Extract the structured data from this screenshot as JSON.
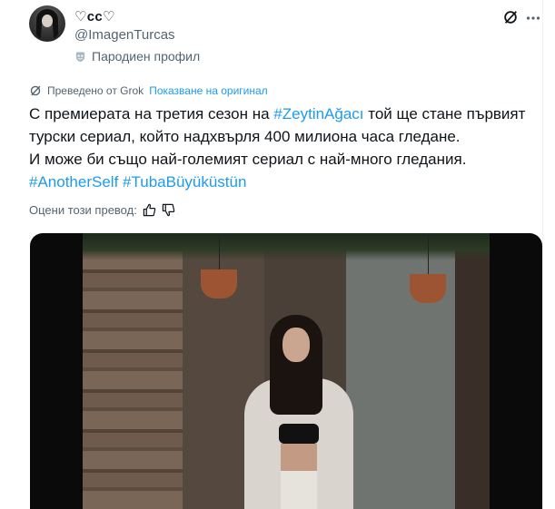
{
  "author": {
    "display_name": "♡ᴄᴄ♡",
    "handle": "@ImagenTurcas",
    "label": "Пародиен профил"
  },
  "translation": {
    "translated_from": "Преведено от Grok",
    "show_original": "Показване на оригинал"
  },
  "tweet": {
    "line1_pre": "С премиерата на третия сезон на ",
    "line1_tag": "#ZeytinAğacı",
    "line1_post": " той ще стане първият",
    "line2": "турски сериал, който надхвърля 400 милиона часа гледане.",
    "line3": "И може би също най-големият сериал с най-много гледания.",
    "hashtag1": "#AnotherSelf",
    "hashtag2": "#TubaBüyüküstün"
  },
  "rate": {
    "label": "Оцени този превод:"
  },
  "icons": {
    "grok": "grok-icon",
    "more": "more-icon",
    "mask": "mask-icon",
    "thumb_up": "thumb-up-icon",
    "thumb_down": "thumb-down-icon"
  },
  "colors": {
    "link": "#1d9bf0",
    "muted": "#536471",
    "text": "#0f1419"
  }
}
